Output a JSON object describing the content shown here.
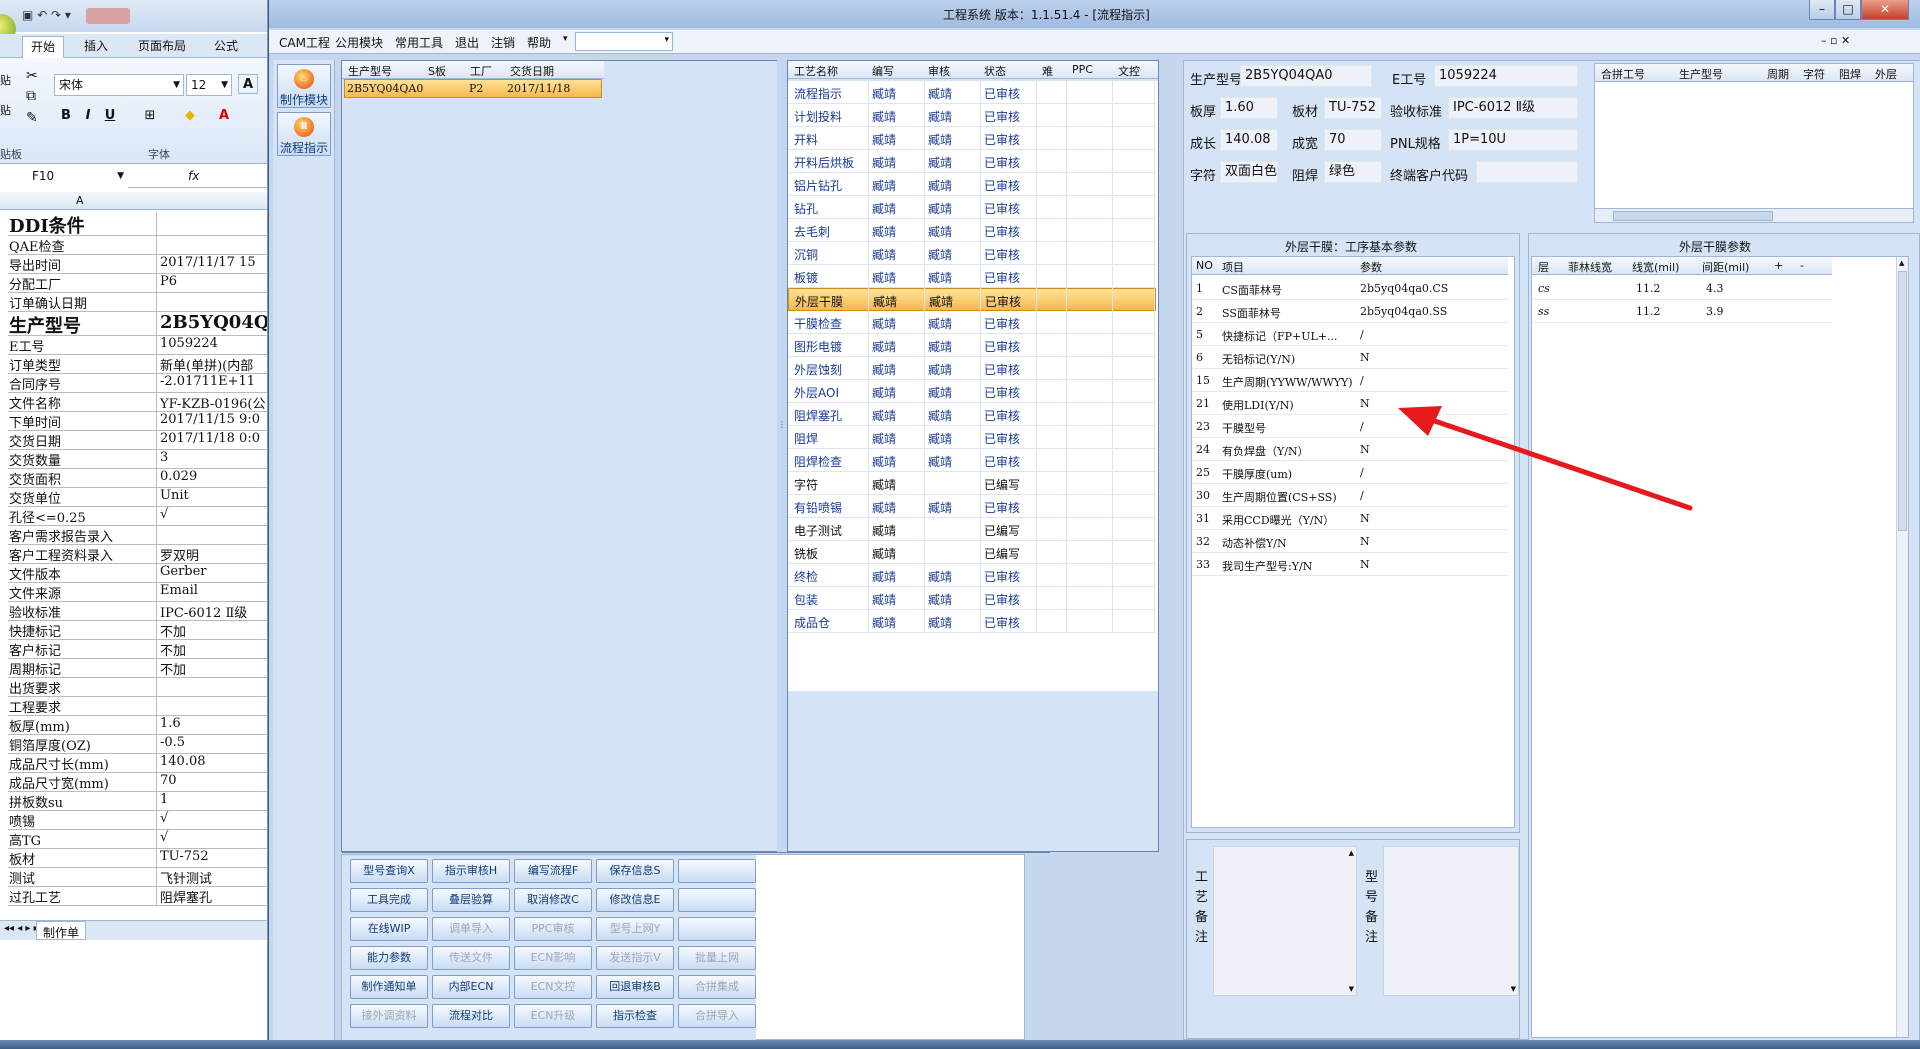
{
  "excel": {
    "tabs": [
      "开始",
      "插入",
      "页面布局",
      "公式"
    ],
    "font_name": "宋体",
    "font_size": "12",
    "group_labels": {
      "clipboard": "贴板",
      "font": "字体"
    },
    "clip_labels": [
      "贴",
      "贴"
    ],
    "name_box": "F10",
    "fx": "fx",
    "col_a": "A",
    "rows": [
      {
        "a": "DDI条件",
        "b": "",
        "big": true
      },
      {
        "a": "QAE检查",
        "b": ""
      },
      {
        "a": "导出时间",
        "b": "2017/11/17 15"
      },
      {
        "a": "分配工厂",
        "b": "P6"
      },
      {
        "a": "订单确认日期",
        "b": ""
      },
      {
        "a": "生产型号",
        "b": "2B5YQ04Q",
        "big": true
      },
      {
        "a": "E工号",
        "b": "1059224"
      },
      {
        "a": "订单类型",
        "b": "新单(单拼)(内部"
      },
      {
        "a": "合同序号",
        "b": "-2.01711E+11"
      },
      {
        "a": "文件名称",
        "b": "YF-KZB-0196(公"
      },
      {
        "a": "下单时间",
        "b": "2017/11/15 9:0"
      },
      {
        "a": "交货日期",
        "b": "2017/11/18 0:0"
      },
      {
        "a": "交货数量",
        "b": "3"
      },
      {
        "a": "交货面积",
        "b": "0.029"
      },
      {
        "a": "交货单位",
        "b": "Unit"
      },
      {
        "a": "孔径<=0.25",
        "b": "√"
      },
      {
        "a": "客户需求报告录入",
        "b": ""
      },
      {
        "a": "客户工程资料录入",
        "b": "罗双明"
      },
      {
        "a": "文件版本",
        "b": "Gerber"
      },
      {
        "a": "文件来源",
        "b": "Email"
      },
      {
        "a": "验收标准",
        "b": "IPC-6012 Ⅱ级"
      },
      {
        "a": "快捷标记",
        "b": "不加"
      },
      {
        "a": "客户标记",
        "b": "不加"
      },
      {
        "a": "周期标记",
        "b": "不加"
      },
      {
        "a": "出货要求",
        "b": ""
      },
      {
        "a": "工程要求",
        "b": ""
      },
      {
        "a": "板厚(mm)",
        "b": "1.6"
      },
      {
        "a": "铜箔厚度(OZ)",
        "b": "-0.5"
      },
      {
        "a": "成品尺寸长(mm)",
        "b": "140.08"
      },
      {
        "a": "成品尺寸宽(mm)",
        "b": "70"
      },
      {
        "a": "拼板数su",
        "b": "1"
      },
      {
        "a": "喷锡",
        "b": "√"
      },
      {
        "a": "高TG",
        "b": "√"
      },
      {
        "a": "板材",
        "b": "TU-752"
      },
      {
        "a": "测试",
        "b": "飞针测试"
      },
      {
        "a": "过孔工艺",
        "b": "阻焊塞孔"
      }
    ],
    "sheet_tab": "制作单"
  },
  "cam": {
    "title": "工程系统   版本：1.1.51.4 - [流程指示]",
    "menu": [
      "CAM工程",
      "公用模块",
      "常用工具",
      "退出",
      "注销",
      "帮助"
    ],
    "tools": [
      {
        "label": "制作模块"
      },
      {
        "label": "流程指示"
      }
    ],
    "model_list": {
      "headers": [
        "生产型号",
        "S板",
        "工厂",
        "交货日期"
      ],
      "rows": [
        {
          "model": "2B5YQ04QA0",
          "s": "",
          "factory": "P2",
          "date": "2017/11/18"
        }
      ]
    },
    "process": {
      "headers": [
        "工艺名称",
        "编写",
        "审核",
        "状态",
        "难",
        "PPC",
        "文控"
      ],
      "rows": [
        {
          "name": "流程指示",
          "w": "臧靖",
          "r": "臧靖",
          "s": "已审核"
        },
        {
          "name": "计划投料",
          "w": "臧靖",
          "r": "臧靖",
          "s": "已审核"
        },
        {
          "name": "开料",
          "w": "臧靖",
          "r": "臧靖",
          "s": "已审核"
        },
        {
          "name": "开料后烘板",
          "w": "臧靖",
          "r": "臧靖",
          "s": "已审核"
        },
        {
          "name": "铝片钻孔",
          "w": "臧靖",
          "r": "臧靖",
          "s": "已审核"
        },
        {
          "name": "钻孔",
          "w": "臧靖",
          "r": "臧靖",
          "s": "已审核"
        },
        {
          "name": "去毛刺",
          "w": "臧靖",
          "r": "臧靖",
          "s": "已审核"
        },
        {
          "name": "沉铜",
          "w": "臧靖",
          "r": "臧靖",
          "s": "已审核"
        },
        {
          "name": "板镀",
          "w": "臧靖",
          "r": "臧靖",
          "s": "已审核"
        },
        {
          "name": "外层干膜",
          "w": "臧靖",
          "r": "臧靖",
          "s": "已审核",
          "sel": true
        },
        {
          "name": "干膜检查",
          "w": "臧靖",
          "r": "臧靖",
          "s": "已审核"
        },
        {
          "name": "图形电镀",
          "w": "臧靖",
          "r": "臧靖",
          "s": "已审核"
        },
        {
          "name": "外层蚀刻",
          "w": "臧靖",
          "r": "臧靖",
          "s": "已审核"
        },
        {
          "name": "外层AOI",
          "w": "臧靖",
          "r": "臧靖",
          "s": "已审核"
        },
        {
          "name": "阻焊塞孔",
          "w": "臧靖",
          "r": "臧靖",
          "s": "已审核"
        },
        {
          "name": "阻焊",
          "w": "臧靖",
          "r": "臧靖",
          "s": "已审核"
        },
        {
          "name": "阻焊检查",
          "w": "臧靖",
          "r": "臧靖",
          "s": "已审核"
        },
        {
          "name": "字符",
          "w": "臧靖",
          "r": "",
          "s": "已编写",
          "dark": true
        },
        {
          "name": "有铅喷锡",
          "w": "臧靖",
          "r": "臧靖",
          "s": "已审核"
        },
        {
          "name": "电子测试",
          "w": "臧靖",
          "r": "",
          "s": "已编写",
          "dark": true
        },
        {
          "name": "铣板",
          "w": "臧靖",
          "r": "",
          "s": "已编写",
          "dark": true
        },
        {
          "name": "终检",
          "w": "臧靖",
          "r": "臧靖",
          "s": "已审核"
        },
        {
          "name": "包装",
          "w": "臧靖",
          "r": "臧靖",
          "s": "已审核"
        },
        {
          "name": "成品仓",
          "w": "臧靖",
          "r": "臧靖",
          "s": "已审核"
        }
      ]
    },
    "buttons": [
      [
        {
          "label": "型号查询X"
        },
        {
          "label": "指示审核H"
        },
        {
          "label": "编写流程F"
        },
        {
          "label": "保存信息S"
        },
        {
          "label": ""
        }
      ],
      [
        {
          "label": "工具完成"
        },
        {
          "label": "叠层验算"
        },
        {
          "label": "取消修改C"
        },
        {
          "label": "修改信息E"
        },
        {
          "label": ""
        }
      ],
      [
        {
          "label": "在线WIP"
        },
        {
          "label": "调单导入",
          "dis": true
        },
        {
          "label": "PPC审核",
          "dis": true
        },
        {
          "label": "型号上网Y",
          "dis": true
        },
        {
          "label": ""
        }
      ],
      [
        {
          "label": "能力参数"
        },
        {
          "label": "传送文件",
          "dis": true
        },
        {
          "label": "ECN影响",
          "dis": true
        },
        {
          "label": "发送指示V",
          "dis": true
        },
        {
          "label": "批量上网",
          "dis": true
        }
      ],
      [
        {
          "label": "制作通知单"
        },
        {
          "label": "内部ECN"
        },
        {
          "label": "ECN文控",
          "dis": true
        },
        {
          "label": "回退审核B"
        },
        {
          "label": "合拼集成",
          "dis": true
        }
      ],
      [
        {
          "label": "接外调资料",
          "dis": true
        },
        {
          "label": "流程对比"
        },
        {
          "label": "ECN升级",
          "dis": true
        },
        {
          "label": "指示检查"
        },
        {
          "label": "合拼导入",
          "dis": true
        }
      ]
    ],
    "info": {
      "model_label": "生产型号",
      "model": "2B5YQ04QA0",
      "e_label": "E工号",
      "e_no": "1059224",
      "thick_label": "板厚",
      "thick": "1.60",
      "mat_label": "板材",
      "mat": "TU-752",
      "std_label": "验收标准",
      "std": "IPC-6012 Ⅱ级",
      "len_label": "成长",
      "len": "140.08",
      "wid_label": "成宽",
      "wid": "70",
      "pnl_label": "PNL规格",
      "pnl": "1P=10U",
      "char_label": "字符",
      "char": "双面白色",
      "mask_label": "阻焊",
      "mask": "绿色",
      "cust_label": "终端客户代码",
      "cust": ""
    },
    "merge_headers": [
      "合拼工号",
      "生产型号",
      "周期",
      "字符",
      "阻焊",
      "外层"
    ],
    "param": {
      "title": "外层干膜：工序基本参数",
      "headers": [
        "NO",
        "项目",
        "参数"
      ],
      "rows": [
        {
          "no": "1",
          "item": "CS面菲林号",
          "val": "2b5yq04qa0.CS"
        },
        {
          "no": "2",
          "item": "SS面菲林号",
          "val": "2b5yq04qa0.SS"
        },
        {
          "no": "5",
          "item": "快捷标记（FP+UL+...",
          "val": "/"
        },
        {
          "no": "6",
          "item": "无铅标记(Y/N)",
          "val": "N"
        },
        {
          "no": "15",
          "item": "生产周期(YYWW/WWYY)",
          "val": "/"
        },
        {
          "no": "21",
          "item": "使用LDI(Y/N)",
          "val": "N"
        },
        {
          "no": "23",
          "item": "干膜型号",
          "val": "/"
        },
        {
          "no": "24",
          "item": "有负焊盘（Y/N）",
          "val": "N"
        },
        {
          "no": "25",
          "item": "干膜厚度(um)",
          "val": "/"
        },
        {
          "no": "30",
          "item": "生产周期位置(CS+SS)",
          "val": "/"
        },
        {
          "no": "31",
          "item": "采用CCD曝光（Y/N）",
          "val": "N"
        },
        {
          "no": "32",
          "item": "动态补偿Y/N",
          "val": "N"
        },
        {
          "no": "33",
          "item": "我司生产型号:Y/N",
          "val": "N"
        }
      ]
    },
    "dryfilm": {
      "title": "外层干膜参数",
      "headers": [
        "层",
        "菲林线宽",
        "线宽(mil)",
        "间距(mil)",
        "+",
        "-"
      ],
      "rows": [
        {
          "layer": "cs",
          "film": "",
          "lw": "11.2",
          "sp": "4.3"
        },
        {
          "layer": "ss",
          "film": "",
          "lw": "11.2",
          "sp": "3.9"
        }
      ]
    },
    "notes": {
      "proc": "工艺备注",
      "model": "型号备注"
    },
    "colors": {
      "accent": "#f6b84c",
      "arrow": "#e8191c",
      "link": "#1a3a9a"
    }
  }
}
